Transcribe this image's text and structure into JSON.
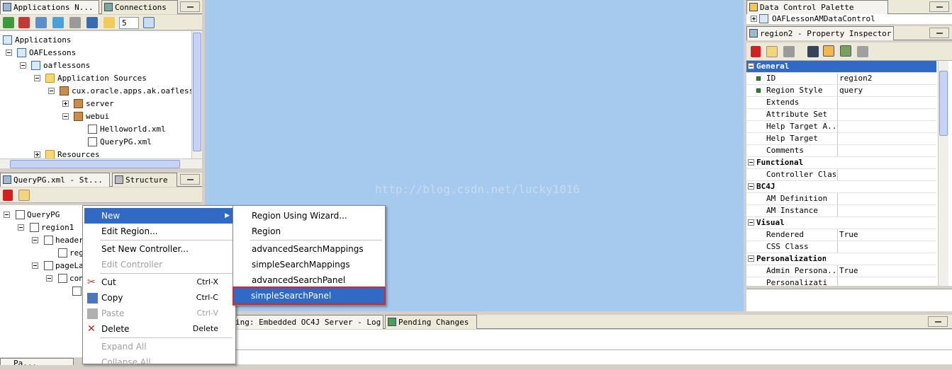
{
  "left_top": {
    "tabs": [
      "Applications N...",
      "Connections"
    ],
    "toolbar": {
      "zoom_value": "5"
    },
    "tree": [
      {
        "label": "Applications",
        "indent": 0,
        "icon": "app"
      },
      {
        "label": "OAFLessons",
        "indent": 1,
        "icon": "proj",
        "exp": "minus"
      },
      {
        "label": "oaflessons",
        "indent": 2,
        "icon": "proj",
        "exp": "minus"
      },
      {
        "label": "Application Sources",
        "indent": 3,
        "icon": "folder",
        "exp": "minus"
      },
      {
        "label": "cux.oracle.apps.ak.oaflesson",
        "indent": 4,
        "icon": "pkg",
        "exp": "minus"
      },
      {
        "label": "server",
        "indent": 5,
        "icon": "pkg",
        "exp": "plus"
      },
      {
        "label": "webui",
        "indent": 5,
        "icon": "pkg",
        "exp": "minus"
      },
      {
        "label": "Helloworld.xml",
        "indent": 6,
        "icon": "xml"
      },
      {
        "label": "QueryPG.xml",
        "indent": 6,
        "icon": "xml"
      },
      {
        "label": "Resources",
        "indent": 3,
        "icon": "folder",
        "exp": "plus"
      }
    ]
  },
  "left_bottom": {
    "tabs": [
      "QueryPG.xml - St...",
      "Structure"
    ],
    "tree": [
      {
        "label": "QueryPG",
        "indent": 0,
        "exp": "minus"
      },
      {
        "label": "region1",
        "indent": 1,
        "exp": "minus"
      },
      {
        "label": "header",
        "indent": 2,
        "exp": "minus"
      },
      {
        "label": "reg",
        "indent": 3
      },
      {
        "label": "pageLa",
        "indent": 2,
        "exp": "minus"
      },
      {
        "label": "con",
        "indent": 3,
        "exp": "minus"
      },
      {
        "label": "",
        "indent": 4
      }
    ],
    "bottom_tab": "Pa..."
  },
  "context_menu": {
    "items": [
      {
        "label": "New",
        "type": "submenu",
        "selected": true,
        "icon": ""
      },
      {
        "label": "Edit Region...",
        "type": "item"
      },
      {
        "type": "sep"
      },
      {
        "label": "Set New Controller...",
        "type": "item"
      },
      {
        "label": "Edit Controller",
        "type": "item",
        "disabled": true
      },
      {
        "type": "sep"
      },
      {
        "label": "Cut",
        "shortcut": "Ctrl-X",
        "icon": "scissors",
        "type": "item"
      },
      {
        "label": "Copy",
        "shortcut": "Ctrl-C",
        "icon": "copy",
        "type": "item"
      },
      {
        "label": "Paste",
        "shortcut": "Ctrl-V",
        "icon": "paste",
        "type": "item",
        "disabled": true
      },
      {
        "label": "Delete",
        "shortcut": "Delete",
        "icon": "delete",
        "type": "item"
      },
      {
        "type": "sep"
      },
      {
        "label": "Expand All",
        "type": "item",
        "disabled": true
      },
      {
        "label": "Collapse All",
        "type": "item",
        "disabled": true
      }
    ]
  },
  "submenu": {
    "items": [
      {
        "label": "Region Using Wizard...",
        "type": "item"
      },
      {
        "label": "Region",
        "type": "item"
      },
      {
        "type": "sep"
      },
      {
        "label": "advancedSearchMappings",
        "type": "item"
      },
      {
        "label": "simpleSearchMappings",
        "type": "item"
      },
      {
        "label": "advancedSearchPanel",
        "type": "item"
      },
      {
        "label": "simpleSearchPanel",
        "type": "item",
        "selected": true,
        "highlight": true
      }
    ],
    "highlight_color": "#e0262a"
  },
  "canvas": {
    "background": "#a6c9ee",
    "watermark": "http://blog.csdn.net/lucky1016"
  },
  "log_area": {
    "tabs": [
      "ing: Embedded OC4J Server - Log",
      "Pending Changes"
    ]
  },
  "right": {
    "data_control_tab": "Data Control Palette",
    "data_control_item": "OAFLessonAMDataControl",
    "inspector_tab": "region2 - Property Inspector",
    "properties": [
      {
        "type": "cat",
        "label": "General"
      },
      {
        "key": "ID",
        "value": "region2",
        "req": true
      },
      {
        "key": "Region Style",
        "value": "query",
        "req": true
      },
      {
        "key": "Extends",
        "value": ""
      },
      {
        "key": "Attribute Set",
        "value": ""
      },
      {
        "key": "Help Target A...",
        "value": ""
      },
      {
        "key": "Help Target",
        "value": ""
      },
      {
        "key": "Comments",
        "value": ""
      },
      {
        "type": "cat",
        "label": "Functional"
      },
      {
        "key": "Controller Class",
        "value": ""
      },
      {
        "type": "cat",
        "label": "BC4J"
      },
      {
        "key": "AM Definition",
        "value": ""
      },
      {
        "key": "AM Instance",
        "value": ""
      },
      {
        "type": "cat",
        "label": "Visual"
      },
      {
        "key": "Rendered",
        "value": "True"
      },
      {
        "key": "CSS Class",
        "value": ""
      },
      {
        "type": "cat",
        "label": "Personalization"
      },
      {
        "key": "Admin Persona...",
        "value": "True"
      },
      {
        "key": "Personalizati",
        "value": ""
      }
    ]
  }
}
